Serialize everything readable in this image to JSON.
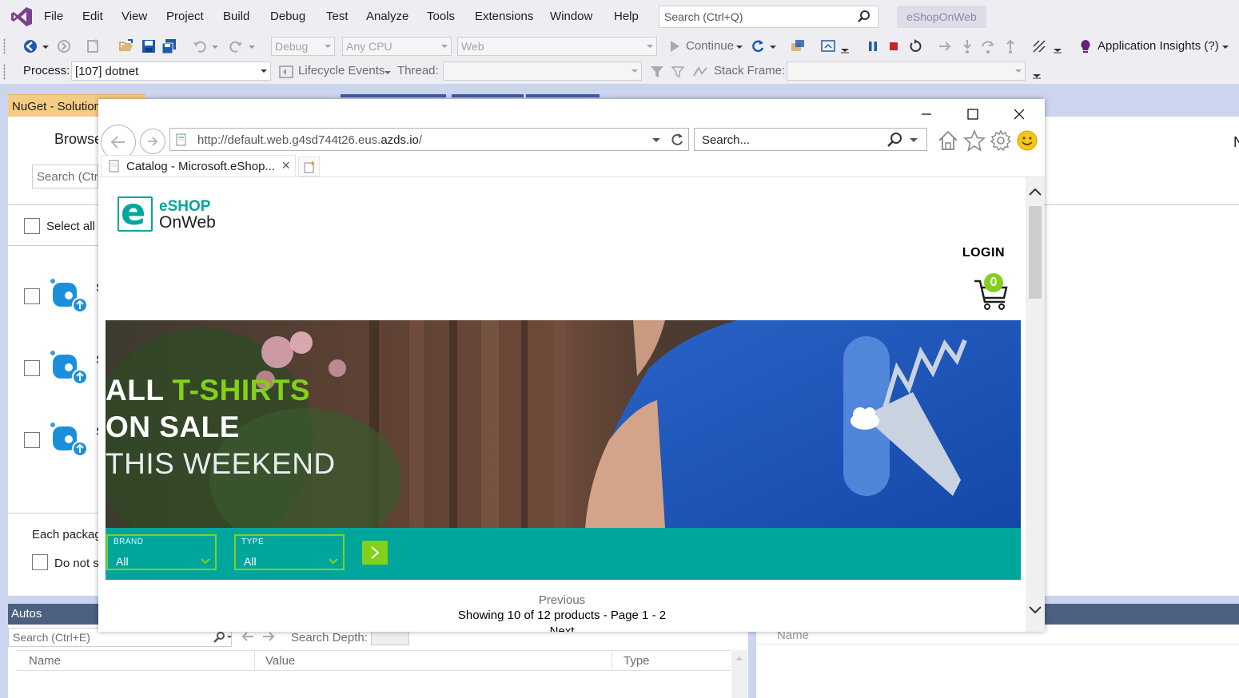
{
  "vs": {
    "menu": [
      "File",
      "Edit",
      "View",
      "Project",
      "Build",
      "Debug",
      "Test",
      "Analyze",
      "Tools",
      "Extensions",
      "Window",
      "Help"
    ],
    "search_placeholder": "Search (Ctrl+Q)",
    "solution_name": "eShopOnWeb",
    "toolbar": {
      "config": "Debug",
      "platform": "Any CPU",
      "startup": "Web",
      "continue_label": "Continue",
      "app_insights": "Application Insights (?)"
    },
    "debug_location": {
      "process_label": "Process:",
      "process_value": "[107] dotnet",
      "lifecycle_label": "Lifecycle Events",
      "thread_label": "Thread:",
      "stack_frame_label": "Stack Frame:"
    }
  },
  "nuget": {
    "tab_title": "NuGet - Solution",
    "browse": "Browse",
    "search_placeholder": "Search (Ctrl",
    "select_all": "Select all",
    "package_peeks": [
      "S",
      "S",
      "S"
    ],
    "footer_text": "Each packag",
    "do_not_show": "Do not s"
  },
  "right_pane_letter": "N",
  "autos": {
    "title": "Autos",
    "search_placeholder": "Search (Ctrl+E)",
    "search_depth_label": "Search Depth:",
    "columns": [
      "Name",
      "Value",
      "Type"
    ]
  },
  "callstack": {
    "columns": [
      "Name"
    ]
  },
  "browser": {
    "url_prefix": "http://default.web.g4sd744t26.eus.",
    "url_domain": "azds.io",
    "url_suffix": "/",
    "search_placeholder": "Search...",
    "tab_title": "Catalog - Microsoft.eShop...",
    "page": {
      "logo_top": "eSHOP",
      "logo_bottom": "OnWeb",
      "login": "LOGIN",
      "cart_count": "0",
      "hero": {
        "line1_a": "ALL ",
        "line1_b": "T-SHIRTS",
        "line2": "ON SALE",
        "line3": "THIS WEEKEND"
      },
      "filters": [
        {
          "label": "BRAND",
          "value": "All"
        },
        {
          "label": "TYPE",
          "value": "All"
        }
      ],
      "pager": {
        "previous": "Previous",
        "info": "Showing 10 of 12 products - Page 1 - 2",
        "next": "Next"
      }
    }
  },
  "colors": {
    "vs_chrome": "#eeeef2",
    "vs_accent": "#ccd5f0",
    "nuget_tab": "#f5cc84",
    "brand_teal": "#00a69c",
    "brand_green": "#83d01b",
    "autos_header": "#4d6082"
  }
}
